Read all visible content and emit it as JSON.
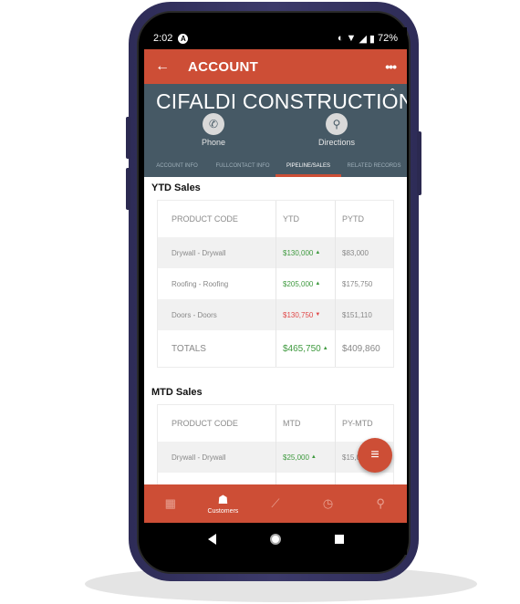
{
  "status_bar": {
    "time": "2:02",
    "notification_icon": "a-icon",
    "battery": "72%",
    "icons": [
      "vibrate-icon",
      "wifi-icon",
      "signal-icon",
      "battery-icon"
    ]
  },
  "app_bar": {
    "back_icon": "←",
    "title": "ACCOUNT",
    "more_icon": "•••"
  },
  "account": {
    "name": "CIFALDI CONSTRUCTION",
    "collapse_icon": "ˆ",
    "actions": [
      {
        "label": "Phone",
        "icon": "✆"
      },
      {
        "label": "Directions",
        "icon": "⚲"
      }
    ]
  },
  "tabs": [
    {
      "label": "ACCOUNT INFO",
      "active": false
    },
    {
      "label": "FULLCONTACT INFO",
      "active": false
    },
    {
      "label": "PIPELINE/SALES",
      "active": true
    },
    {
      "label": "RELATED RECORDS",
      "active": false
    }
  ],
  "ytd": {
    "title": "YTD Sales",
    "headers": [
      "PRODUCT CODE",
      "YTD",
      "PYTD"
    ],
    "rows": [
      {
        "product": "Drywall - Drywall",
        "current": "$130,000",
        "trend": "up",
        "prior": "$83,000"
      },
      {
        "product": "Roofing - Roofing",
        "current": "$205,000",
        "trend": "up",
        "prior": "$175,750"
      },
      {
        "product": "Doors - Doors",
        "current": "$130,750",
        "trend": "down",
        "prior": "$151,110"
      }
    ],
    "totals": {
      "label": "TOTALS",
      "current": "$465,750",
      "trend": "up",
      "prior": "$409,860"
    }
  },
  "mtd": {
    "title": "MTD Sales",
    "headers": [
      "PRODUCT CODE",
      "MTD",
      "PY-MTD"
    ],
    "rows": [
      {
        "product": "Drywall - Drywall",
        "current": "$25,000",
        "trend": "up",
        "prior": "$15,000"
      }
    ]
  },
  "fab": {
    "icon": "≡"
  },
  "bottom_nav": [
    {
      "name": "calendar",
      "icon": "▦",
      "label": "",
      "active": false
    },
    {
      "name": "customers",
      "icon": "☗",
      "label": "Customers",
      "active": true
    },
    {
      "name": "chart",
      "icon": "⟋",
      "label": "",
      "active": false
    },
    {
      "name": "clock",
      "icon": "◷",
      "label": "",
      "active": false
    },
    {
      "name": "search",
      "icon": "⚲",
      "label": "",
      "active": false
    }
  ],
  "arrows": {
    "up": "▲",
    "down": "▼"
  }
}
